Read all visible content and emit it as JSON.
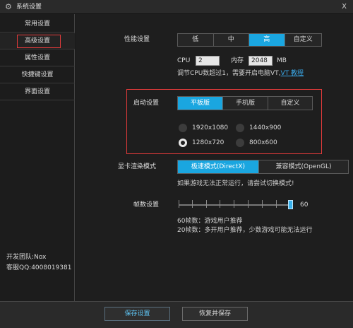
{
  "window": {
    "title": "系统设置",
    "close": "X"
  },
  "sidebar": {
    "items": [
      {
        "label": "常用设置"
      },
      {
        "label": "高级设置",
        "active": true
      },
      {
        "label": "属性设置"
      },
      {
        "label": "快捷键设置"
      },
      {
        "label": "界面设置"
      }
    ],
    "team": "开发团队:Nox",
    "support": "客服QQ:4008019381"
  },
  "performance": {
    "label": "性能设置",
    "options": [
      "低",
      "中",
      "高",
      "自定义"
    ],
    "selected": "高",
    "cpu_label": "CPU",
    "cpu_value": "2",
    "memory_label": "内存",
    "memory_value": "2048",
    "memory_unit": "MB",
    "tip_text": "调节CPU数超过1，需要开启电脑VT,",
    "tip_link": "VT 教程"
  },
  "startup": {
    "label": "启动设置",
    "options": [
      "平板版",
      "手机版",
      "自定义"
    ],
    "selected": "平板版",
    "resolutions": [
      "1920x1080",
      "1440x900",
      "1280x720",
      "800x600"
    ],
    "selected_resolution": "1280x720"
  },
  "render": {
    "label": "显卡渲染模式",
    "options": [
      "极速模式(DirectX)",
      "兼容模式(OpenGL)"
    ],
    "selected": "极速模式(DirectX)",
    "tip": "如果游戏无法正常运行，请尝试切换模式!"
  },
  "fps": {
    "label": "帧数设置",
    "value": "60",
    "note1": "60帧数：游戏用户推荐",
    "note2": "20帧数：多开用户推荐，少数游戏可能无法运行"
  },
  "footer": {
    "save": "保存设置",
    "restore": "恢复并保存"
  },
  "colors": {
    "accent": "#1aa6e0",
    "highlight_border": "#e03a3a"
  }
}
